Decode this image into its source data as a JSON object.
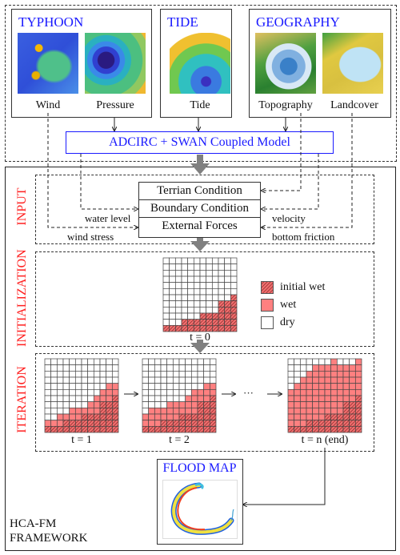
{
  "typhoon": {
    "title": "TYPHOON",
    "captions": [
      "Wind",
      "Pressure"
    ]
  },
  "tide": {
    "title": "TIDE",
    "captions": [
      "Tide"
    ]
  },
  "geography": {
    "title": "GEOGRAPHY",
    "captions": [
      "Topography",
      "Landcover"
    ]
  },
  "model": {
    "label": "ADCIRC + SWAN Coupled Model"
  },
  "sections": {
    "input": "INPUT",
    "initialization": "INITIALIZATION",
    "iteration": "ITERATION"
  },
  "conditions": [
    "Terrian Condition",
    "Boundary Condition",
    "External Forces"
  ],
  "flow_labels": {
    "water_level": "water level",
    "wind_stress": "wind stress",
    "velocity": "velocity",
    "bottom_friction": "bottom friction"
  },
  "legend": {
    "initial_wet": "initial wet",
    "wet": "wet",
    "dry": "dry"
  },
  "grids": {
    "size": 12,
    "t0": {
      "label": "t = 0",
      "initial": [
        1,
        1,
        1,
        2,
        2,
        2,
        3,
        3,
        3,
        5,
        5,
        6
      ],
      "wet": [
        0,
        0,
        0,
        0,
        0,
        0,
        0,
        0,
        0,
        0,
        0,
        0
      ]
    },
    "t1": {
      "label": "t = 1",
      "initial": [
        1,
        1,
        1,
        2,
        2,
        2,
        3,
        3,
        3,
        5,
        5,
        6
      ],
      "wet": [
        2,
        2,
        3,
        3,
        4,
        4,
        4,
        5,
        6,
        7,
        8,
        8
      ]
    },
    "t2": {
      "label": "t = 2",
      "initial": [
        1,
        1,
        1,
        2,
        2,
        2,
        3,
        3,
        3,
        5,
        5,
        6
      ],
      "wet": [
        3,
        4,
        4,
        4,
        5,
        5,
        5,
        6,
        7,
        7,
        8,
        8
      ]
    },
    "tn": {
      "label": "t = n (end)",
      "initial": [
        1,
        1,
        1,
        2,
        2,
        2,
        3,
        3,
        3,
        5,
        5,
        6
      ],
      "wet": [
        7,
        8,
        9,
        10,
        11,
        11,
        11,
        12,
        11,
        11,
        11,
        12
      ]
    }
  },
  "ellipsis": "···",
  "flood_map": {
    "title": "FLOOD MAP"
  },
  "framework": {
    "line1": "HCA-FM",
    "line2": "FRAMEWORK"
  },
  "colors": {
    "title_blue": "#1a1aff",
    "section_red": "#ff2020",
    "wet": "#ff8080",
    "initial_wet": "#e85a5a",
    "arrow_gray": "#808080"
  }
}
